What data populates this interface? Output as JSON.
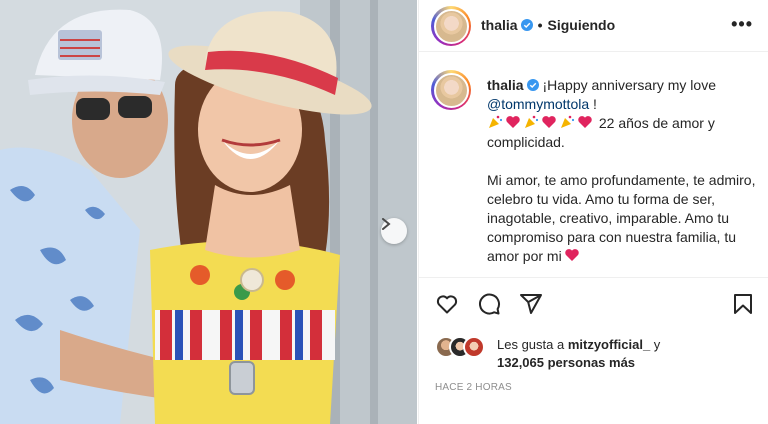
{
  "header": {
    "username": "thalia",
    "follow_status": "Siguiendo",
    "separator": "•",
    "more_label": "•••"
  },
  "caption": {
    "username": "thalia",
    "line1": "¡Happy anniversary my love",
    "mention": "@tommymottola",
    "mention_suffix": " !",
    "anniversary": " 22 años de amor y complicidad.",
    "body": "Mi amor, te amo profundamente, te admiro, celebro tu vida. Amo tu forma de ser, inagotable, creativo, imparable. Amo tu compromiso para con nuestra familia, tu amor por mi"
  },
  "actions": {
    "like": "heart-icon",
    "comment": "comment-icon",
    "share": "share-icon",
    "save": "bookmark-icon"
  },
  "likes": {
    "prefix": "Les gusta a ",
    "user": "mitzyofficial_",
    "connector": " y",
    "count": "132,065 personas más"
  },
  "timestamp": "HACE 2 HORAS",
  "colors": {
    "verified": "#3897f0",
    "mention": "#00376b",
    "heart_emoji": "#e0245e",
    "border": "#efefef",
    "muted": "#8e8e8e"
  }
}
